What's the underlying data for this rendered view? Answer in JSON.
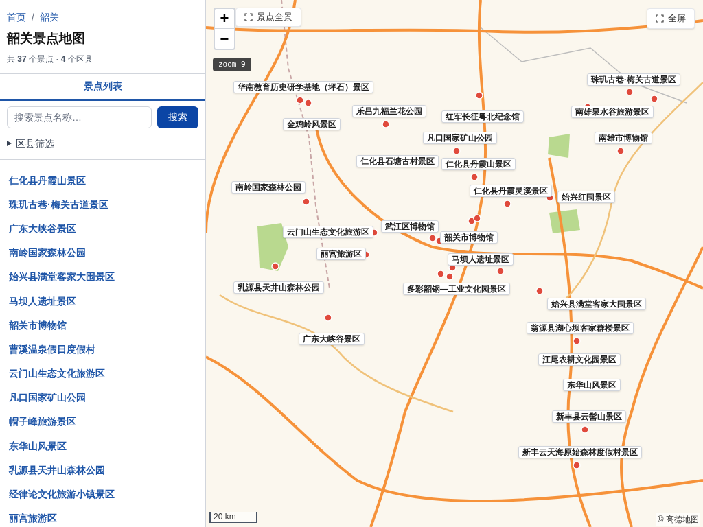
{
  "breadcrumb": [
    {
      "label": "首页"
    },
    {
      "label": "韶关"
    }
  ],
  "breadcrumb_separator": "/",
  "title": "韶关景点地图",
  "summary": "共 **37** 个景点 · **4** 个区县",
  "tabs": [
    {
      "label": "景点列表",
      "selected": true
    }
  ],
  "search": {
    "placeholder": "搜索景点名称…",
    "button": "搜索"
  },
  "district_filter": {
    "label": "区县筛选",
    "expanded": false
  },
  "attractions": [
    "仁化县丹霞山景区",
    "珠玑古巷·梅关古道景区",
    "广东大峡谷景区",
    "南岭国家森林公园",
    "始兴县满堂客家大围景区",
    "马坝人遗址景区",
    "韶关市博物馆",
    "曹溪温泉假日度假村",
    "云门山生态文化旅游区",
    "凡口国家矿山公园",
    "帽子峰旅游景区",
    "东华山风景区",
    "乳源县天井山森林公园",
    "经律论文化旅游小镇景区",
    "丽宫旅游区"
  ],
  "map": {
    "zoom_in": "+",
    "zoom_out": "−",
    "fit_button": "景点全景",
    "zoom_badge": "zoom 9",
    "fullscreen_button": "全屏",
    "scale": "20 km",
    "attribution": "© 高德地图",
    "markers": [
      "华南教育历史研学基地（坪石）景区",
      "乐昌九福兰花公园",
      "金鸡岭风景区",
      "红军长征粤北纪念馆",
      "凡口国家矿山公园",
      "仁化县石塘古村景区",
      "仁化县丹霞山景区",
      "珠玑古巷·梅关古道景区",
      "南雄泉水谷旅游景区",
      "南雄市博物馆",
      "南岭国家森林公园",
      "仁化县丹霞灵溪景区",
      "始兴红围景区",
      "云门山生态文化旅游区",
      "武江区博物馆",
      "韶关市博物馆",
      "丽宫旅游区",
      "马坝人遗址景区",
      "乳源县天井山森林公园",
      "多彩韶钢—工业文化园景区",
      "始兴县满堂客家大围景区",
      "广东大峡谷景区",
      "翁源县湖心坝客家群楼景区",
      "江尾农耕文化园景区",
      "东华山风景区",
      "新丰县云髻山景区",
      "新丰云天海原始森林度假村景区"
    ]
  }
}
